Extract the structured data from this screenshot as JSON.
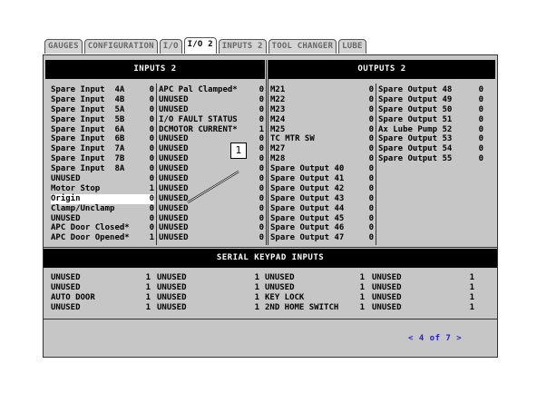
{
  "tabs": [
    {
      "label": "GAUGES",
      "active": false
    },
    {
      "label": "CONFIGURATION",
      "active": false
    },
    {
      "label": "I/O",
      "active": false
    },
    {
      "label": "I/O 2",
      "active": true
    },
    {
      "label": "INPUTS 2",
      "active": false
    },
    {
      "label": "TOOL CHANGER",
      "active": false
    },
    {
      "label": "LUBE",
      "active": false
    }
  ],
  "inputs_header": "INPUTS 2",
  "outputs_header": "OUTPUTS 2",
  "serial_header": "SERIAL KEYPAD INPUTS",
  "inputs_col1": [
    {
      "name": "Spare Input  4A",
      "value": "0"
    },
    {
      "name": "Spare Input  4B",
      "value": "0"
    },
    {
      "name": "Spare Input  5A",
      "value": "0"
    },
    {
      "name": "Spare Input  5B",
      "value": "0"
    },
    {
      "name": "Spare Input  6A",
      "value": "0"
    },
    {
      "name": "Spare Input  6B",
      "value": "0"
    },
    {
      "name": "Spare Input  7A",
      "value": "0"
    },
    {
      "name": "Spare Input  7B",
      "value": "0"
    },
    {
      "name": "Spare Input  8A",
      "value": "0"
    },
    {
      "name": "UNUSED",
      "value": "0"
    },
    {
      "name": "Motor Stop",
      "value": "1"
    },
    {
      "name": "Origin",
      "value": "0"
    },
    {
      "name": "Clamp/Unclamp",
      "value": "0"
    },
    {
      "name": "UNUSED",
      "value": "0"
    },
    {
      "name": "APC Door Closed*",
      "value": "0"
    },
    {
      "name": "APC Door Opened*",
      "value": "1"
    }
  ],
  "inputs_col2": [
    {
      "name": "APC Pal Clamped*",
      "value": "0"
    },
    {
      "name": "UNUSED",
      "value": "0"
    },
    {
      "name": "UNUSED",
      "value": "0"
    },
    {
      "name": "I/O FAULT STATUS",
      "value": "0"
    },
    {
      "name": "DCMOTOR CURRENT*",
      "value": "1"
    },
    {
      "name": "UNUSED",
      "value": "0"
    },
    {
      "name": "UNUSED",
      "value": "0"
    },
    {
      "name": "UNUSED",
      "value": "0"
    },
    {
      "name": "UNUSED",
      "value": "0"
    },
    {
      "name": "UNUSED",
      "value": "0"
    },
    {
      "name": "UNUSED",
      "value": "0"
    },
    {
      "name": "UNUSED",
      "value": "0"
    },
    {
      "name": "UNUSED",
      "value": "0"
    },
    {
      "name": "UNUSED",
      "value": "0"
    },
    {
      "name": "UNUSED",
      "value": "0"
    },
    {
      "name": "UNUSED",
      "value": "0"
    }
  ],
  "outputs_col1": [
    {
      "name": "M21",
      "value": "0"
    },
    {
      "name": "M22",
      "value": "0"
    },
    {
      "name": "M23",
      "value": "0"
    },
    {
      "name": "M24",
      "value": "0"
    },
    {
      "name": "M25",
      "value": "0"
    },
    {
      "name": "TC MTR SW",
      "value": "0"
    },
    {
      "name": "M27",
      "value": "0"
    },
    {
      "name": "M28",
      "value": "0"
    },
    {
      "name": "Spare Output 40",
      "value": "0"
    },
    {
      "name": "Spare Output 41",
      "value": "0"
    },
    {
      "name": "Spare Output 42",
      "value": "0"
    },
    {
      "name": "Spare Output 43",
      "value": "0"
    },
    {
      "name": "Spare Output 44",
      "value": "0"
    },
    {
      "name": "Spare Output 45",
      "value": "0"
    },
    {
      "name": "Spare Output 46",
      "value": "0"
    },
    {
      "name": "Spare Output 47",
      "value": "0"
    }
  ],
  "outputs_col2": [
    {
      "name": "Spare Output 48",
      "value": "0"
    },
    {
      "name": "Spare Output 49",
      "value": "0"
    },
    {
      "name": "Spare Output 50",
      "value": "0"
    },
    {
      "name": "Spare Output 51",
      "value": "0"
    },
    {
      "name": "Ax Lube Pump 52",
      "value": "0"
    },
    {
      "name": "Spare Output 53",
      "value": "0"
    },
    {
      "name": "Spare Output 54",
      "value": "0"
    },
    {
      "name": "Spare Output 55",
      "value": "0"
    }
  ],
  "serial_col1": [
    {
      "name": "UNUSED",
      "value": "1"
    },
    {
      "name": "UNUSED",
      "value": "1"
    },
    {
      "name": "AUTO DOOR",
      "value": "1"
    },
    {
      "name": "UNUSED",
      "value": "1"
    }
  ],
  "serial_col2": [
    {
      "name": "UNUSED",
      "value": "1"
    },
    {
      "name": "UNUSED",
      "value": "1"
    },
    {
      "name": "UNUSED",
      "value": "1"
    },
    {
      "name": "UNUSED",
      "value": "1"
    }
  ],
  "serial_col3": [
    {
      "name": "UNUSED",
      "value": "1"
    },
    {
      "name": "UNUSED",
      "value": "1"
    },
    {
      "name": "KEY LOCK",
      "value": "1"
    },
    {
      "name": "2ND HOME SWITCH",
      "value": "1"
    }
  ],
  "serial_col4": [
    {
      "name": "UNUSED",
      "value": "1"
    },
    {
      "name": "UNUSED",
      "value": "1"
    },
    {
      "name": "UNUSED",
      "value": "1"
    },
    {
      "name": "UNUSED",
      "value": "1"
    }
  ],
  "callout_number": "1",
  "pager": "< 4 of 7 >",
  "highlighted_row": "Origin",
  "colors": {
    "header_bg": "#000000",
    "panel_bg": "#c6c6c6",
    "highlight": "#ffffff",
    "pager": "#2222cc"
  }
}
